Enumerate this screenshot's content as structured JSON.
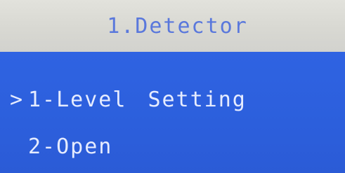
{
  "screen": {
    "title": "1.Detector",
    "colors": {
      "title_bg": "#dcdcd6",
      "title_text": "#5a78dc",
      "menu_bg": "#2e62dc",
      "menu_text": "#e6ecff"
    }
  },
  "menu": {
    "cursor": ">",
    "items": [
      {
        "label": "1-Level",
        "suffix": "Setting",
        "selected": true
      },
      {
        "label": "2-Open",
        "suffix": "",
        "selected": false
      }
    ]
  }
}
